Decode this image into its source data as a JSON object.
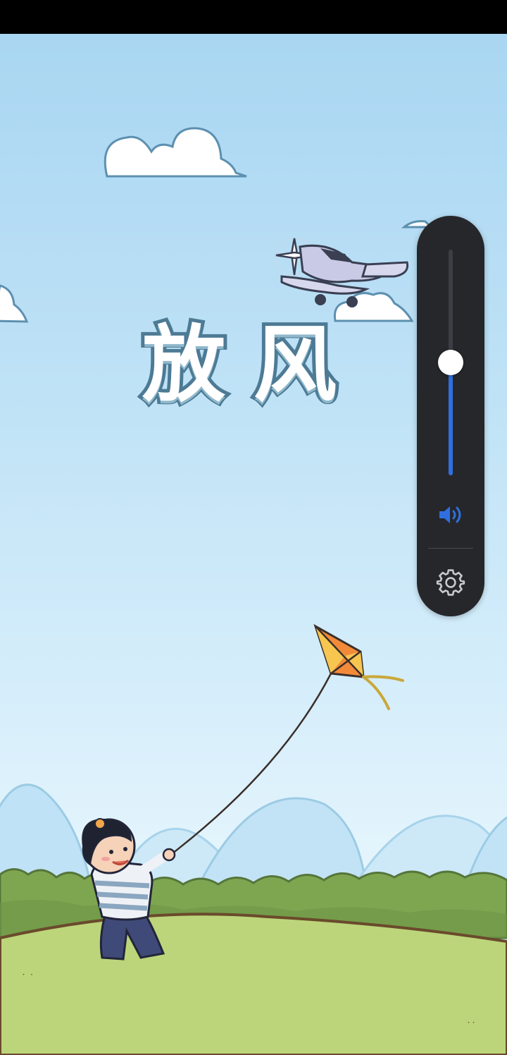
{
  "game": {
    "title": "放风"
  },
  "volume_panel": {
    "level": 0.5,
    "accent_color": "#2f6fe0",
    "speaker_icon": "speaker-volume-icon",
    "settings_icon": "gear-icon"
  }
}
